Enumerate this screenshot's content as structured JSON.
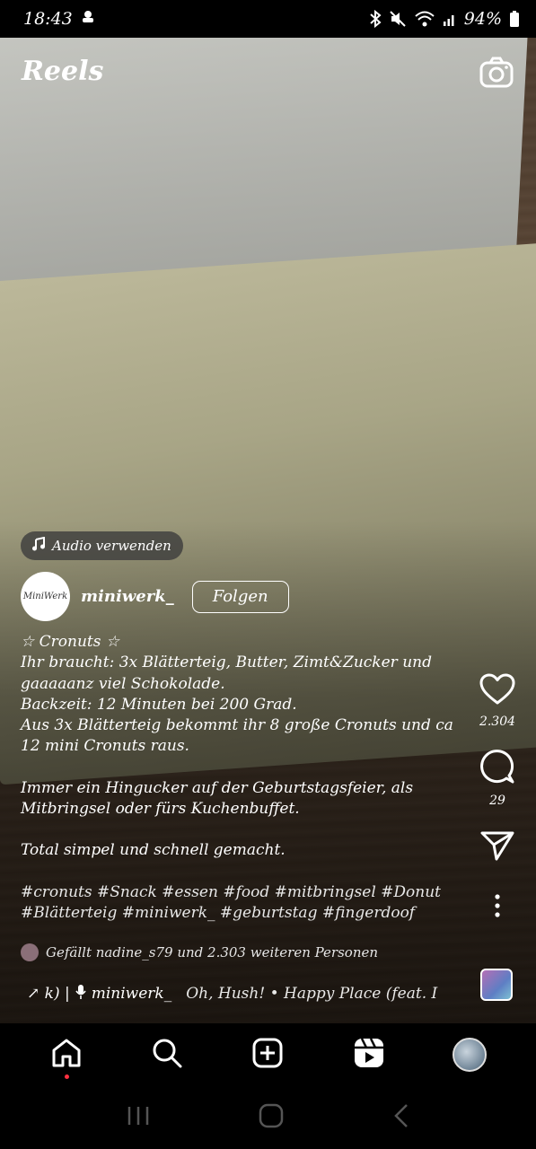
{
  "status_bar": {
    "time": "18:43",
    "battery": "94%"
  },
  "header": {
    "title": "Reels"
  },
  "audio_pill": {
    "label": "Audio verwenden"
  },
  "author": {
    "username": "miniwerk_",
    "avatar_text": "MiniWerk",
    "follow_label": "Folgen"
  },
  "caption": {
    "lines": [
      "☆ Cronuts ☆",
      "Ihr braucht: 3x Blätterteig, Butter, Zimt&Zucker und gaaaaanz viel Schokolade.",
      "Backzeit: 12 Minuten bei 200 Grad.",
      "Aus 3x Blätterteig bekommt ihr 8 große Cronuts und ca 12 mini Cronuts raus."
    ],
    "paragraph2": "Immer ein Hingucker auf der Geburtstagsfeier, als Mitbringsel oder fürs Kuchenbuffet.",
    "paragraph3": "Total simpel und schnell gemacht.",
    "hashtags": "#cronuts #Snack #essen #food #mitbringsel #Donut #Blätterteig #miniwerk_ #geburtstag #fingerdoof"
  },
  "likes": {
    "text": "Gefällt nadine_s79 und 2.303 weiteren Personen"
  },
  "music": {
    "prefix": "↗ k) |",
    "artist": "miniwerk_",
    "track": "Oh, Hush! • Happy Place (feat. I"
  },
  "actions": {
    "like_count": "2.304",
    "comment_count": "29"
  },
  "icons": {
    "camera": "camera-icon",
    "music_note": "music-note-icon",
    "heart": "heart-icon",
    "comment": "comment-icon",
    "share": "send-icon",
    "more": "more-vertical-icon",
    "home": "home-icon",
    "search": "search-icon",
    "create": "create-icon",
    "reels": "reels-icon"
  },
  "colors": {
    "notification_dot": "#ff3040"
  }
}
